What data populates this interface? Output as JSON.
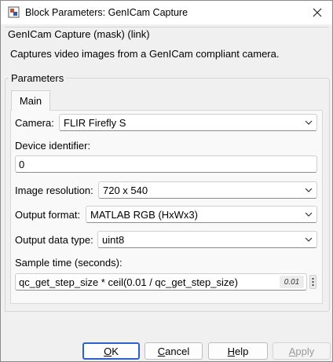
{
  "window": {
    "title": "Block Parameters: GenICam Capture",
    "app_icon": "simulink-block-icon",
    "close_icon": "close-icon"
  },
  "mask": {
    "title": "GenICam Capture (mask) (link)",
    "description": "Captures video images from a GenICam compliant camera."
  },
  "parameters": {
    "group_label": "Parameters",
    "tabs": [
      {
        "label": "Main",
        "selected": true
      }
    ],
    "camera": {
      "label": "Camera:",
      "value": "FLIR Firefly S"
    },
    "device_identifier": {
      "label": "Device identifier:",
      "value": "0"
    },
    "image_resolution": {
      "label": "Image resolution:",
      "value": "720 x 540"
    },
    "output_format": {
      "label": "Output format:",
      "value": "MATLAB RGB (HxWx3)"
    },
    "output_data_type": {
      "label": "Output data type:",
      "value": "uint8"
    },
    "sample_time": {
      "label": "Sample time (seconds):",
      "value": "qc_get_step_size * ceil(0.01 / qc_get_step_size)",
      "evaluated": "0.01"
    }
  },
  "buttons": {
    "ok": {
      "pre": "",
      "underlined": "O",
      "post": "K"
    },
    "cancel": {
      "pre": "",
      "underlined": "C",
      "post": "ancel"
    },
    "help": {
      "pre": "",
      "underlined": "H",
      "post": "elp"
    },
    "apply": {
      "pre": "",
      "underlined": "A",
      "post": "pply"
    }
  },
  "colors": {
    "default_button_border": "#2b62c8",
    "disabled_text": "#9a9a9a",
    "window_bg": "#f0f0f0"
  }
}
